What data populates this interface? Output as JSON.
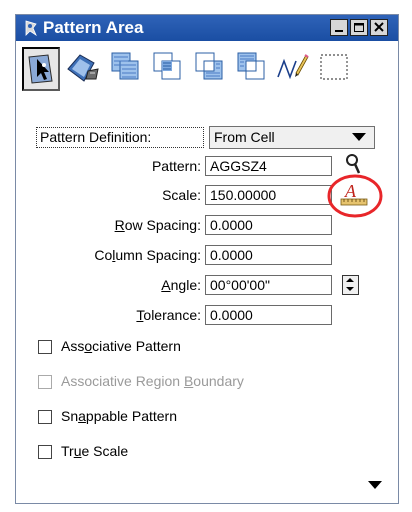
{
  "window": {
    "title": "Pattern Area",
    "title_icon": "cell-pattern-icon",
    "controls": {
      "minimize": "minimize-icon",
      "maximize": "maximize-icon",
      "close": "close-icon"
    }
  },
  "toolbar": {
    "tools": [
      {
        "name": "pattern-element-tool",
        "icon": "pattern-element-icon",
        "selected": true
      },
      {
        "name": "pattern-flood-tool",
        "icon": "flood-pattern-icon",
        "selected": false
      },
      {
        "name": "pattern-union-tool",
        "icon": "union-pattern-icon",
        "selected": false
      },
      {
        "name": "pattern-intersection-tool",
        "icon": "intersection-pattern-icon",
        "selected": false
      },
      {
        "name": "pattern-difference-tool",
        "icon": "difference-pattern-icon",
        "selected": false
      },
      {
        "name": "pattern-fence-tool",
        "icon": "overlap-pattern-icon",
        "selected": false
      },
      {
        "name": "pattern-points-tool",
        "icon": "points-pattern-icon",
        "selected": false
      },
      {
        "name": "pattern-fence-dotted-tool",
        "icon": "fence-icon",
        "selected": false
      }
    ]
  },
  "form": {
    "pattern_definition": {
      "label": "Pattern Definition:",
      "value": "From Cell"
    },
    "pattern": {
      "label": "Pattern:",
      "value": "AGGSZ4"
    },
    "scale": {
      "label": "Scale:",
      "value": "150.00000"
    },
    "row_spacing": {
      "label": "Row Spacing:",
      "value": "0.0000"
    },
    "column_spacing": {
      "label": "Column Spacing:",
      "value": "0.0000"
    },
    "angle": {
      "label": "Angle:",
      "value": "00°00'00\""
    },
    "tolerance": {
      "label": "Tolerance:",
      "value": "0.0000"
    }
  },
  "options": [
    {
      "label": "Associative Pattern",
      "checked": false,
      "enabled": true
    },
    {
      "label": "Associative Region Boundary",
      "checked": false,
      "enabled": false
    },
    {
      "label": "Snappable Pattern",
      "checked": false,
      "enabled": true
    },
    {
      "label": "True Scale",
      "checked": false,
      "enabled": true
    }
  ],
  "highlight_color": "#e8262a"
}
